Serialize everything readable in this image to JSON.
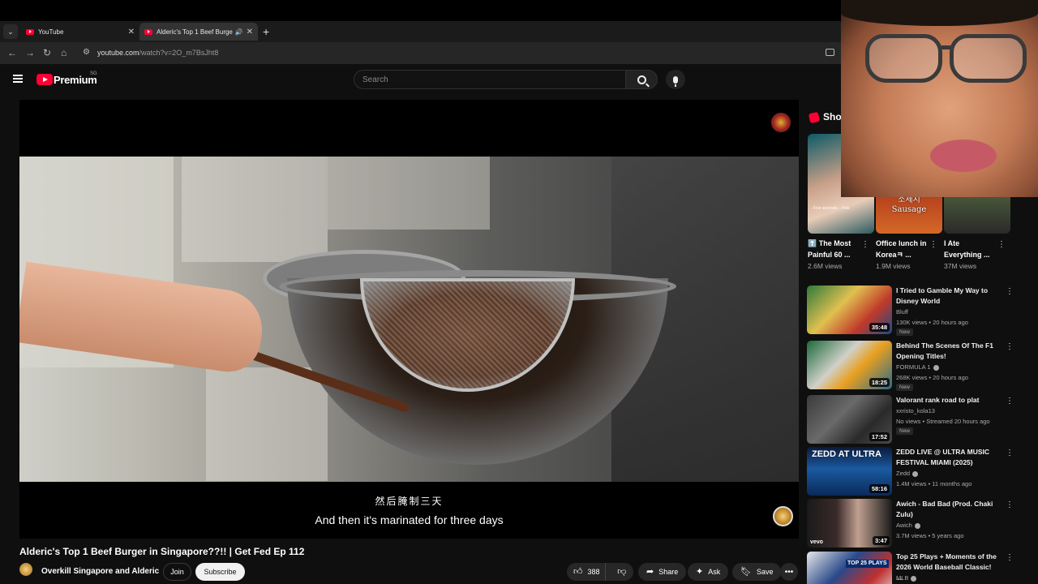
{
  "browser": {
    "tabs": [
      {
        "title": "YouTube",
        "active": false
      },
      {
        "title": "Alderic's Top 1 Beef Burger",
        "active": true
      }
    ],
    "new_tab_icon": "plus-icon",
    "url_host": "youtube.com",
    "url_path": "/watch?v=2O_m7BsJht8"
  },
  "youtube": {
    "logo_text": "Premium",
    "logo_sup": "SG",
    "search_placeholder": "Search"
  },
  "player": {
    "caption_zh": "然后腌制三天",
    "caption_en": "And then it's marinated for three days"
  },
  "video": {
    "title": "Alderic's Top 1 Beef Burger in Singapore??!! | Get Fed Ep 112",
    "channel": "Overkill Singapore and Alderic",
    "join_label": "Join",
    "subscribe_label": "Subscribe",
    "likes": "388",
    "share_label": "Share",
    "ask_label": "Ask",
    "save_label": "Save"
  },
  "shorts": {
    "heading": "Shorts",
    "items": [
      {
        "title": "⬆️ The Most Painful 60 ...",
        "views": "2.6M views",
        "overlay": "- Five seconds. - Five"
      },
      {
        "title": "Office lunch in Koreaㅋ ...",
        "views": "1.9M views",
        "overlay_ko": "소세지",
        "overlay_en": "Sausage"
      },
      {
        "title": "I Ate Everything ...",
        "views": "37M views"
      }
    ]
  },
  "recommendations": [
    {
      "title": "I Tried to Gamble My Way to Disney World",
      "channel": "Bluff",
      "meta": "130K views • 20 hours ago",
      "badge": "New",
      "duration": "35:48",
      "verified": false
    },
    {
      "title": "Behind The Scenes Of The F1 Opening Titles!",
      "channel": "FORMULA 1",
      "meta": "268K views • 20 hours ago",
      "badge": "New",
      "duration": "18:25",
      "verified": true
    },
    {
      "title": "Valorant rank road to plat",
      "channel": "xxristo_kola13",
      "meta": "No views • Streamed 20 hours ago",
      "badge": "New",
      "duration": "17:52",
      "verified": false
    },
    {
      "title": "ZEDD LIVE @ ULTRA MUSIC FESTIVAL MIAMI (2025)",
      "channel": "Zedd",
      "meta": "1.4M views • 11 months ago",
      "badge": "",
      "duration": "58:16",
      "verified": true,
      "thumb_text": "ZEDD AT ULTRA"
    },
    {
      "title": "Awich - Bad Bad (Prod. Chaki Zulu)",
      "channel": "Awich",
      "meta": "3.7M views • 5 years ago",
      "badge": "",
      "duration": "3:47",
      "verified": true,
      "thumb_text": "vevo"
    },
    {
      "title": "Top 25 Plays + Moments of the 2026 World Baseball Classic! ...",
      "channel": "MLB",
      "meta": "",
      "badge": "",
      "duration": "",
      "verified": true,
      "thumb_text": "TOP 25 PLAYS"
    }
  ],
  "colors": {
    "brand": "#ff0033",
    "bg": "#0f0f0f",
    "pill": "#272727"
  }
}
